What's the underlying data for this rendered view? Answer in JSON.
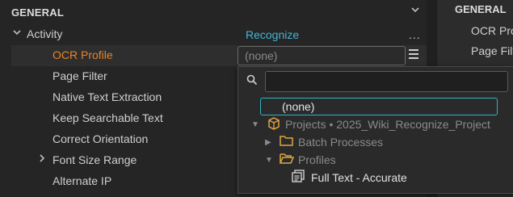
{
  "section": {
    "title": "GENERAL"
  },
  "properties": [
    {
      "label": "Activity"
    },
    {
      "label": "OCR Profile"
    },
    {
      "label": "Page Filter"
    },
    {
      "label": "Native Text Extraction"
    },
    {
      "label": "Keep Searchable Text"
    },
    {
      "label": "Correct Orientation"
    },
    {
      "label": "Font Size Range"
    },
    {
      "label": "Alternate IP"
    }
  ],
  "activity_value": "Recognize",
  "ellipsis": "...",
  "ocr_profile": {
    "value": "(none)"
  },
  "dropdown": {
    "search_value": "",
    "none_option": "(none)",
    "project": "Projects • 2025_Wiki_Recognize_Project",
    "batch": "Batch Processes",
    "profiles": "Profiles",
    "profile_item": "Full Text - Accurate"
  },
  "right_panel": {
    "title": "GENERAL",
    "items": [
      "OCR Profile",
      "Page Filter"
    ]
  },
  "colors": {
    "selected_label": "#e8832a",
    "activity_value": "#3fb6d6",
    "focus_border": "#2fb5c5",
    "folder": "#e0a640",
    "project_icon": "#e0a640"
  },
  "icons": [
    "chevron-down-icon",
    "expand-arrow-icon",
    "menu-icon",
    "search-icon",
    "cube-icon",
    "folder-icon",
    "open-folder-icon",
    "document-stack-icon"
  ]
}
